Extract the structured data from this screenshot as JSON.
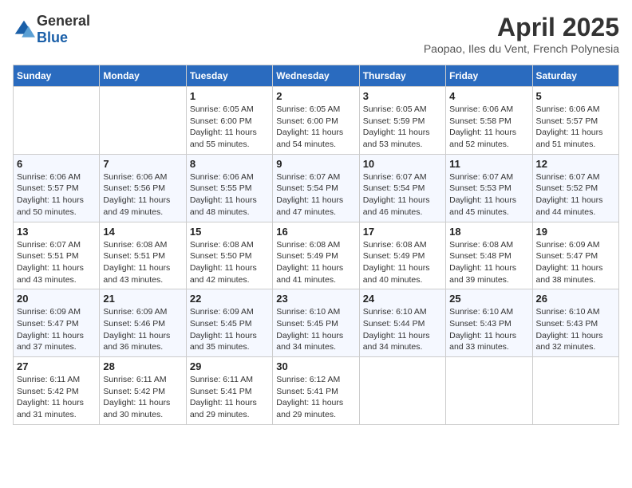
{
  "header": {
    "logo_general": "General",
    "logo_blue": "Blue",
    "title": "April 2025",
    "subtitle": "Paopao, Iles du Vent, French Polynesia"
  },
  "weekdays": [
    "Sunday",
    "Monday",
    "Tuesday",
    "Wednesday",
    "Thursday",
    "Friday",
    "Saturday"
  ],
  "weeks": [
    [
      {
        "day": "",
        "sunrise": "",
        "sunset": "",
        "daylight": ""
      },
      {
        "day": "",
        "sunrise": "",
        "sunset": "",
        "daylight": ""
      },
      {
        "day": "1",
        "sunrise": "Sunrise: 6:05 AM",
        "sunset": "Sunset: 6:00 PM",
        "daylight": "Daylight: 11 hours and 55 minutes."
      },
      {
        "day": "2",
        "sunrise": "Sunrise: 6:05 AM",
        "sunset": "Sunset: 6:00 PM",
        "daylight": "Daylight: 11 hours and 54 minutes."
      },
      {
        "day": "3",
        "sunrise": "Sunrise: 6:05 AM",
        "sunset": "Sunset: 5:59 PM",
        "daylight": "Daylight: 11 hours and 53 minutes."
      },
      {
        "day": "4",
        "sunrise": "Sunrise: 6:06 AM",
        "sunset": "Sunset: 5:58 PM",
        "daylight": "Daylight: 11 hours and 52 minutes."
      },
      {
        "day": "5",
        "sunrise": "Sunrise: 6:06 AM",
        "sunset": "Sunset: 5:57 PM",
        "daylight": "Daylight: 11 hours and 51 minutes."
      }
    ],
    [
      {
        "day": "6",
        "sunrise": "Sunrise: 6:06 AM",
        "sunset": "Sunset: 5:57 PM",
        "daylight": "Daylight: 11 hours and 50 minutes."
      },
      {
        "day": "7",
        "sunrise": "Sunrise: 6:06 AM",
        "sunset": "Sunset: 5:56 PM",
        "daylight": "Daylight: 11 hours and 49 minutes."
      },
      {
        "day": "8",
        "sunrise": "Sunrise: 6:06 AM",
        "sunset": "Sunset: 5:55 PM",
        "daylight": "Daylight: 11 hours and 48 minutes."
      },
      {
        "day": "9",
        "sunrise": "Sunrise: 6:07 AM",
        "sunset": "Sunset: 5:54 PM",
        "daylight": "Daylight: 11 hours and 47 minutes."
      },
      {
        "day": "10",
        "sunrise": "Sunrise: 6:07 AM",
        "sunset": "Sunset: 5:54 PM",
        "daylight": "Daylight: 11 hours and 46 minutes."
      },
      {
        "day": "11",
        "sunrise": "Sunrise: 6:07 AM",
        "sunset": "Sunset: 5:53 PM",
        "daylight": "Daylight: 11 hours and 45 minutes."
      },
      {
        "day": "12",
        "sunrise": "Sunrise: 6:07 AM",
        "sunset": "Sunset: 5:52 PM",
        "daylight": "Daylight: 11 hours and 44 minutes."
      }
    ],
    [
      {
        "day": "13",
        "sunrise": "Sunrise: 6:07 AM",
        "sunset": "Sunset: 5:51 PM",
        "daylight": "Daylight: 11 hours and 43 minutes."
      },
      {
        "day": "14",
        "sunrise": "Sunrise: 6:08 AM",
        "sunset": "Sunset: 5:51 PM",
        "daylight": "Daylight: 11 hours and 43 minutes."
      },
      {
        "day": "15",
        "sunrise": "Sunrise: 6:08 AM",
        "sunset": "Sunset: 5:50 PM",
        "daylight": "Daylight: 11 hours and 42 minutes."
      },
      {
        "day": "16",
        "sunrise": "Sunrise: 6:08 AM",
        "sunset": "Sunset: 5:49 PM",
        "daylight": "Daylight: 11 hours and 41 minutes."
      },
      {
        "day": "17",
        "sunrise": "Sunrise: 6:08 AM",
        "sunset": "Sunset: 5:49 PM",
        "daylight": "Daylight: 11 hours and 40 minutes."
      },
      {
        "day": "18",
        "sunrise": "Sunrise: 6:08 AM",
        "sunset": "Sunset: 5:48 PM",
        "daylight": "Daylight: 11 hours and 39 minutes."
      },
      {
        "day": "19",
        "sunrise": "Sunrise: 6:09 AM",
        "sunset": "Sunset: 5:47 PM",
        "daylight": "Daylight: 11 hours and 38 minutes."
      }
    ],
    [
      {
        "day": "20",
        "sunrise": "Sunrise: 6:09 AM",
        "sunset": "Sunset: 5:47 PM",
        "daylight": "Daylight: 11 hours and 37 minutes."
      },
      {
        "day": "21",
        "sunrise": "Sunrise: 6:09 AM",
        "sunset": "Sunset: 5:46 PM",
        "daylight": "Daylight: 11 hours and 36 minutes."
      },
      {
        "day": "22",
        "sunrise": "Sunrise: 6:09 AM",
        "sunset": "Sunset: 5:45 PM",
        "daylight": "Daylight: 11 hours and 35 minutes."
      },
      {
        "day": "23",
        "sunrise": "Sunrise: 6:10 AM",
        "sunset": "Sunset: 5:45 PM",
        "daylight": "Daylight: 11 hours and 34 minutes."
      },
      {
        "day": "24",
        "sunrise": "Sunrise: 6:10 AM",
        "sunset": "Sunset: 5:44 PM",
        "daylight": "Daylight: 11 hours and 34 minutes."
      },
      {
        "day": "25",
        "sunrise": "Sunrise: 6:10 AM",
        "sunset": "Sunset: 5:43 PM",
        "daylight": "Daylight: 11 hours and 33 minutes."
      },
      {
        "day": "26",
        "sunrise": "Sunrise: 6:10 AM",
        "sunset": "Sunset: 5:43 PM",
        "daylight": "Daylight: 11 hours and 32 minutes."
      }
    ],
    [
      {
        "day": "27",
        "sunrise": "Sunrise: 6:11 AM",
        "sunset": "Sunset: 5:42 PM",
        "daylight": "Daylight: 11 hours and 31 minutes."
      },
      {
        "day": "28",
        "sunrise": "Sunrise: 6:11 AM",
        "sunset": "Sunset: 5:42 PM",
        "daylight": "Daylight: 11 hours and 30 minutes."
      },
      {
        "day": "29",
        "sunrise": "Sunrise: 6:11 AM",
        "sunset": "Sunset: 5:41 PM",
        "daylight": "Daylight: 11 hours and 29 minutes."
      },
      {
        "day": "30",
        "sunrise": "Sunrise: 6:12 AM",
        "sunset": "Sunset: 5:41 PM",
        "daylight": "Daylight: 11 hours and 29 minutes."
      },
      {
        "day": "",
        "sunrise": "",
        "sunset": "",
        "daylight": ""
      },
      {
        "day": "",
        "sunrise": "",
        "sunset": "",
        "daylight": ""
      },
      {
        "day": "",
        "sunrise": "",
        "sunset": "",
        "daylight": ""
      }
    ]
  ]
}
